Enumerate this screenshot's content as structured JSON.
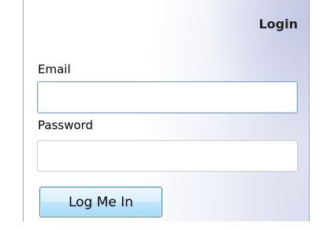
{
  "login_form": {
    "title": "Login",
    "email_label": "Email",
    "email_value": "",
    "password_label": "Password",
    "password_value": "",
    "submit_label": "Log Me In"
  }
}
